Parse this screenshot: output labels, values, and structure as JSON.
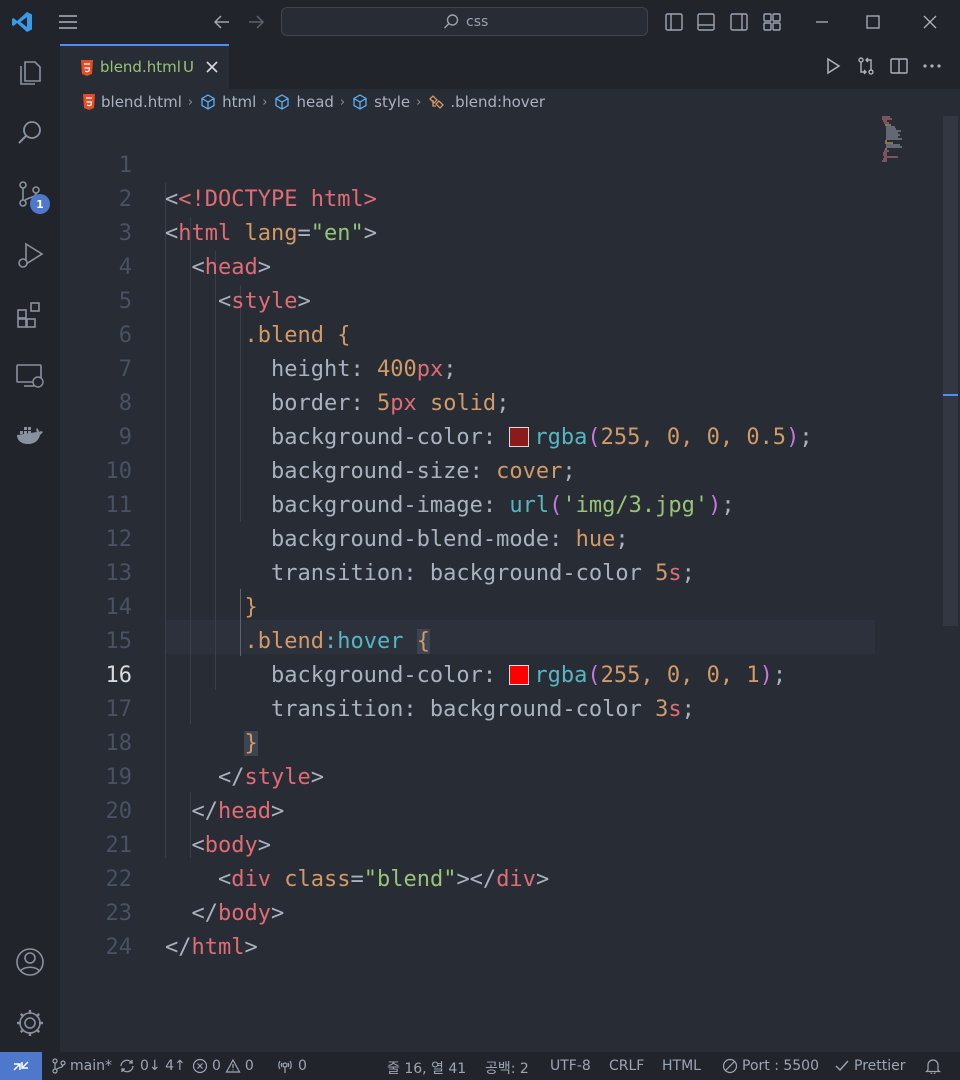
{
  "titlebar": {
    "search_text": "css"
  },
  "activity": {
    "scm_badge": "1"
  },
  "tab": {
    "label": "blend.html",
    "status": "U"
  },
  "breadcrumb": {
    "file": "blend.html",
    "items": [
      "html",
      "head",
      "style",
      ".blend:hover"
    ]
  },
  "editor": {
    "active_line": 16,
    "lines": [
      {
        "n": "1"
      },
      {
        "n": "2"
      },
      {
        "n": "3"
      },
      {
        "n": "4"
      },
      {
        "n": "5"
      },
      {
        "n": "6"
      },
      {
        "n": "7"
      },
      {
        "n": "8"
      },
      {
        "n": "9"
      },
      {
        "n": "10"
      },
      {
        "n": "11"
      },
      {
        "n": "12"
      },
      {
        "n": "13"
      },
      {
        "n": "14"
      },
      {
        "n": "15"
      },
      {
        "n": "16"
      },
      {
        "n": "17"
      },
      {
        "n": "18"
      },
      {
        "n": "19"
      },
      {
        "n": "20"
      },
      {
        "n": "21"
      },
      {
        "n": "22"
      },
      {
        "n": "23"
      },
      {
        "n": "24"
      }
    ],
    "code": {
      "l1": "<!DOCTYPE html>",
      "l2_tag": "html",
      "l2_attr": "lang",
      "l2_val": "\"en\"",
      "l3": "head",
      "l4": "style",
      "l5_sel": ".blend",
      "l6_prop": "height",
      "l6_num": "400",
      "l6_unit": "px",
      "l7_prop": "border",
      "l7_num": "5",
      "l7_unit": "px",
      "l7_kw": "solid",
      "l8_prop": "background-color",
      "l8_fn": "rgba",
      "l8_args": "255, 0, 0, 0.5",
      "l9_prop": "background-size",
      "l9_kw": "cover",
      "l10_prop": "background-image",
      "l10_fn": "url",
      "l10_str": "'img/3.jpg'",
      "l11_prop": "background-blend-mode",
      "l11_kw": "hue",
      "l12_prop": "transition",
      "l12_kw": "background-color",
      "l12_num": "5",
      "l12_unit": "s",
      "l14_sel": ".blend",
      "l14_pseudo": ":hover",
      "l15_prop": "background-color",
      "l15_fn": "rgba",
      "l15_args": "255, 0, 0, 1",
      "l16_prop": "transition",
      "l16_kw": "background-color",
      "l16_num": "3",
      "l16_unit": "s",
      "l18": "style",
      "l19": "head",
      "l20": "body",
      "l21_tag": "div",
      "l21_attr": "class",
      "l21_val": "\"blend\"",
      "l22": "body",
      "l23": "html"
    },
    "swatch_colors": [
      "#8b1a1a",
      "#ff0000"
    ]
  },
  "statusbar": {
    "branch": "main*",
    "sync": "0↓ 4↑",
    "errors": "0",
    "warnings": "0",
    "ports": "0",
    "position": "줄 16, 열 41",
    "spaces": "공백: 2",
    "encoding": "UTF-8",
    "eol": "CRLF",
    "language": "HTML",
    "live_server": "Port : 5500",
    "prettier": "Prettier"
  },
  "colors": {
    "accent": "#528bff",
    "remote_bg": "#4d78cc"
  }
}
